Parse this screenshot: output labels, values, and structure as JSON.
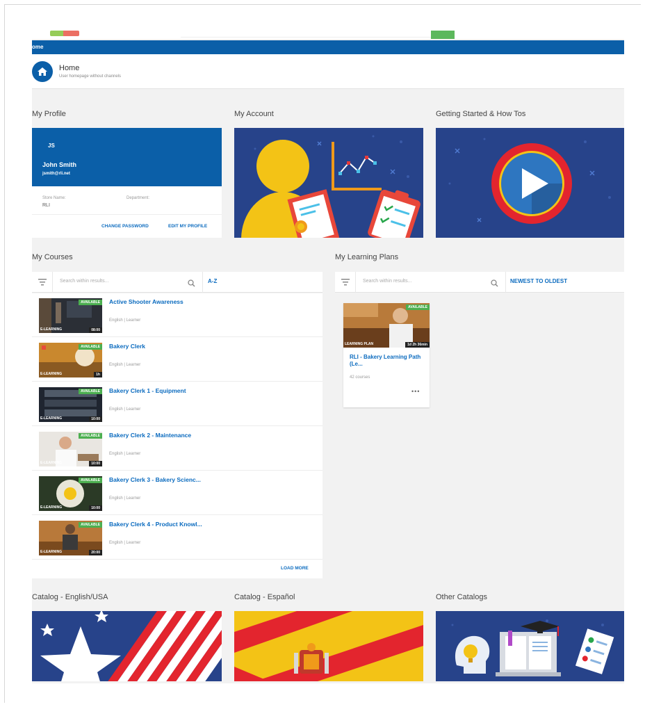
{
  "header": {
    "nav_label": "ome",
    "page_title": "Home",
    "page_subtitle": "User homepage without channels"
  },
  "profile": {
    "section_title": "My Profile",
    "initials": "JS",
    "name": "John Smith",
    "email": "jsmith@rli.net",
    "store_label": "Store Name:",
    "store_value": "RLI",
    "department_label": "Department:",
    "change_password": "CHANGE PASSWORD",
    "edit_profile": "EDIT MY PROFILE"
  },
  "account": {
    "section_title": "My Account"
  },
  "getting_started": {
    "section_title": "Getting Started & How Tos"
  },
  "courses": {
    "section_title": "My Courses",
    "search_placeholder": "Search within results...",
    "sort": "A-Z",
    "load_more": "LOAD MORE",
    "items": [
      {
        "title": "Active Shooter Awareness",
        "meta": "English | Learner",
        "status": "AVAILABLE",
        "type": "E-LEARNING",
        "duration": "08:00"
      },
      {
        "title": "Bakery Clerk",
        "meta": "English | Learner",
        "status": "AVAILABLE",
        "type": "E-LEARNING",
        "duration": "1h"
      },
      {
        "title": "Bakery Clerk 1 - Equipment",
        "meta": "English | Learner",
        "status": "AVAILABLE",
        "type": "E-LEARNING",
        "duration": "10:00"
      },
      {
        "title": "Bakery Clerk 2 - Maintenance",
        "meta": "English | Learner",
        "status": "AVAILABLE",
        "type": "E-LEARNING",
        "duration": "10:00"
      },
      {
        "title": "Bakery Clerk 3 - Bakery Scienc...",
        "meta": "English | Learner",
        "status": "AVAILABLE",
        "type": "E-LEARNING",
        "duration": "10:00"
      },
      {
        "title": "Bakery Clerk 4 - Product Knowl...",
        "meta": "English | Learner",
        "status": "AVAILABLE",
        "type": "E-LEARNING",
        "duration": "20:00"
      }
    ]
  },
  "plans": {
    "section_title": "My Learning Plans",
    "search_placeholder": "Search within results...",
    "sort": "NEWEST TO OLDEST",
    "card": {
      "status": "AVAILABLE",
      "type": "LEARNING PLAN",
      "duration": "1d 2h 36min",
      "title": "RLI - Bakery Learning Path (Le...",
      "count": "42 courses",
      "more": "•••"
    }
  },
  "catalogs": {
    "english": "Catalog - English/USA",
    "spanish": "Catalog - Español",
    "other": "Other Catalogs"
  },
  "colors": {
    "brand_blue": "#0b5fa8",
    "link_blue": "#0b6bbf",
    "available_green": "#4caf50",
    "illustration_navy": "#27438a"
  }
}
